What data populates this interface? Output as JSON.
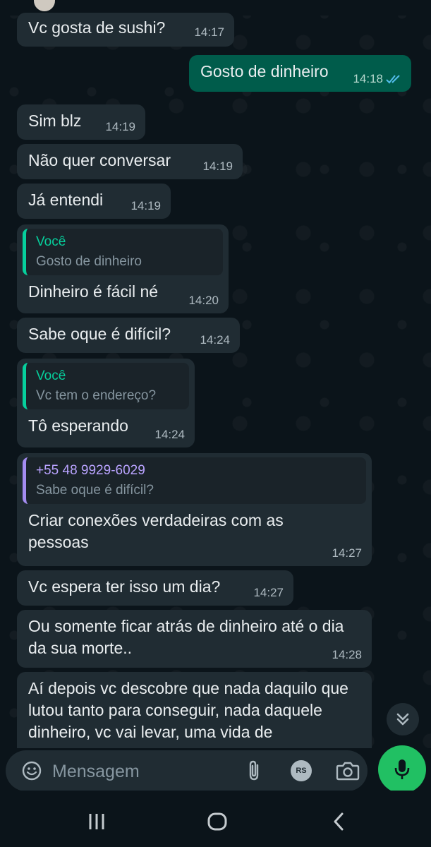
{
  "messages": [
    {
      "dir": "in",
      "text": "Vc gosta de sushi?",
      "time": "14:17"
    },
    {
      "dir": "out",
      "text": "Gosto de dinheiro",
      "time": "14:18",
      "status": "read"
    },
    {
      "dir": "in",
      "text": "Sim blz",
      "time": "14:19"
    },
    {
      "dir": "in",
      "text": "Não quer conversar",
      "time": "14:19"
    },
    {
      "dir": "in",
      "text": "Já entendi",
      "time": "14:19"
    },
    {
      "dir": "in",
      "quote": {
        "author": "Você",
        "text": "Gosto de dinheiro"
      },
      "text": "Dinheiro é fácil né",
      "time": "14:20"
    },
    {
      "dir": "in",
      "text": "Sabe oque é difícil?",
      "time": "14:24"
    },
    {
      "dir": "in",
      "quote": {
        "author": "Você",
        "text": "Vc tem o endereço?"
      },
      "text": "Tô esperando",
      "time": "14:24"
    },
    {
      "dir": "in",
      "quote": {
        "author": "+55 48 9929-6029",
        "text": "Sabe oque é difícil?"
      },
      "text": "Criar conexões verdadeiras com as pessoas",
      "time": "14:27"
    },
    {
      "dir": "in",
      "text": "Vc espera ter isso um dia?",
      "time": "14:27"
    },
    {
      "dir": "in",
      "text": "Ou somente ficar atrás de dinheiro até o dia da sua morte..",
      "time": "14:28"
    },
    {
      "dir": "in",
      "text": "Aí depois vc descobre que nada daquilo que lutou tanto para conseguir, nada daquele dinheiro, vc vai levar, uma vida de"
    }
  ],
  "input": {
    "placeholder": "Mensagem",
    "badge": "RS"
  },
  "icons": {
    "scroll": "double-chevron-down-icon",
    "emoji": "emoji-icon",
    "attach": "paperclip-icon",
    "camera": "camera-icon",
    "mic": "mic-icon",
    "read_status": "double-check-icon"
  },
  "colors": {
    "background": "#0b141a",
    "incoming_bubble": "#202c33",
    "outgoing_bubble": "#005c4b",
    "quote_you": "#06cf9c",
    "quote_contact": "#a48cf0",
    "read_ticks": "#53bdeb",
    "mic_button": "#21c063"
  }
}
